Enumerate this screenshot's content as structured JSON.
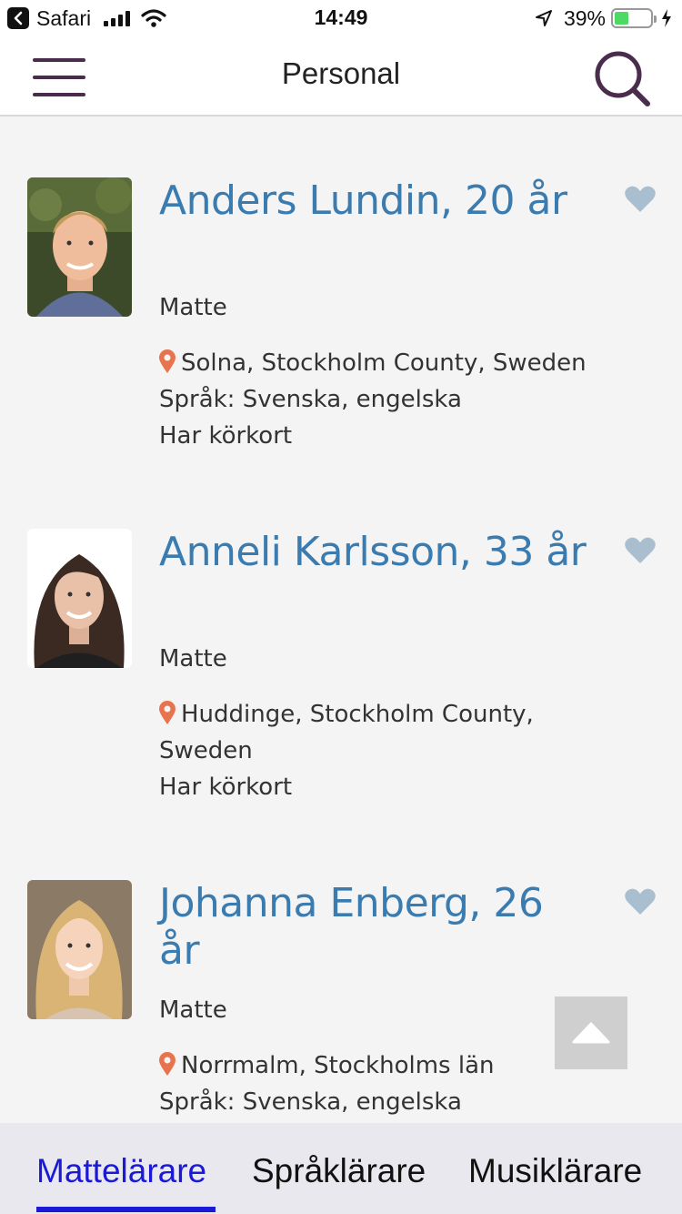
{
  "status_bar": {
    "app": "Safari",
    "time": "14:49",
    "battery_percent": "39%",
    "battery_level": 0.39
  },
  "header": {
    "title": "Personal"
  },
  "people": [
    {
      "name": "Anders Lundin, 20 år",
      "subject": "Matte",
      "location": "Solna, Stockholm County, Sweden",
      "extra": [
        "Språk: Svenska, engelska",
        "Har körkort"
      ]
    },
    {
      "name": "Anneli Karlsson, 33 år",
      "subject": "Matte",
      "location": "Huddinge, Stockholm County, Sweden",
      "extra": [
        "Har körkort"
      ]
    },
    {
      "name": "Johanna Enberg, 26 år",
      "subject": "Matte",
      "location": "Norrmalm, Stockholms län",
      "extra": [
        "Språk: Svenska, engelska"
      ]
    }
  ],
  "tabs": [
    {
      "label": "Mattelärare",
      "active": true
    },
    {
      "label": "Språklärare",
      "active": false
    },
    {
      "label": "Musiklärare",
      "active": false
    }
  ],
  "colors": {
    "accent_blue": "#3a7bb0",
    "active_tab": "#1a1ad6",
    "pin": "#e8734f",
    "heart": "#a9bfcf",
    "menu_icon": "#4a2d4c"
  },
  "icons": [
    "menu-icon",
    "search-icon",
    "heart-icon",
    "location-pin-icon",
    "arrow-up-icon"
  ]
}
